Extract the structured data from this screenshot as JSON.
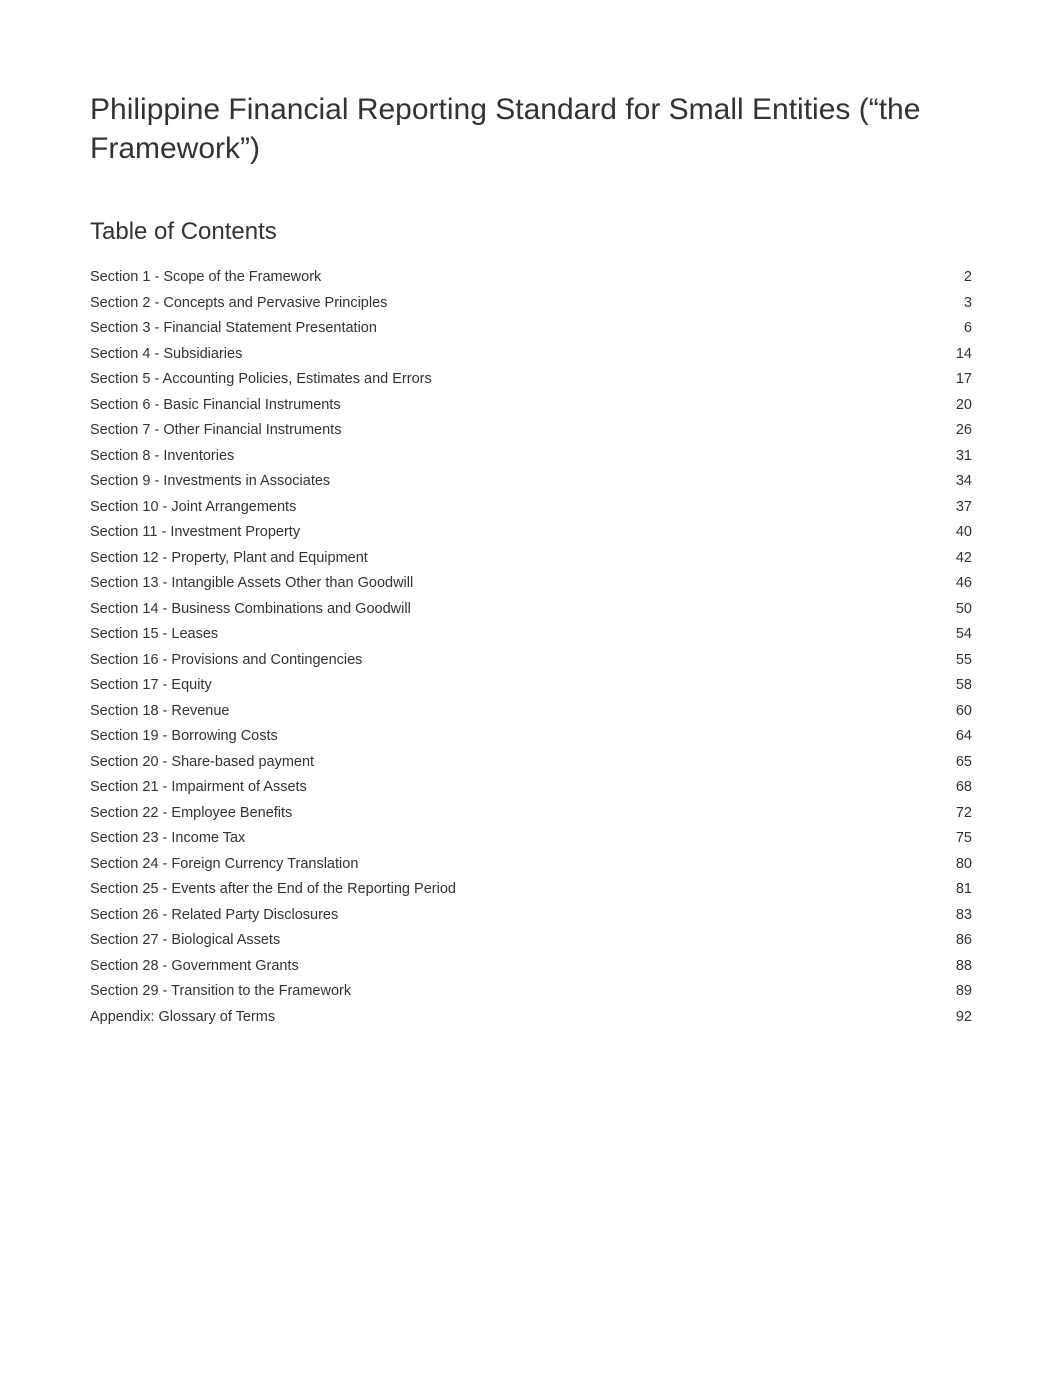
{
  "title": "Philippine Financial Reporting Standard for Small Entities (“the Framework”)",
  "toc_heading": "Table of Contents",
  "toc": [
    {
      "label": "Section 1 - Scope of the Framework",
      "page": "2"
    },
    {
      "label": "Section 2 - Concepts and Pervasive Principles",
      "page": "3"
    },
    {
      "label": "Section 3 - Financial Statement Presentation",
      "page": "6"
    },
    {
      "label": "Section 4 - Subsidiaries",
      "page": "14"
    },
    {
      "label": "Section 5 - Accounting Policies, Estimates and Errors",
      "page": "17"
    },
    {
      "label": "Section 6 - Basic Financial Instruments",
      "page": "20"
    },
    {
      "label": "Section 7 - Other Financial Instruments",
      "page": "26"
    },
    {
      "label": "Section 8 - Inventories",
      "page": "31"
    },
    {
      "label": "Section 9 - Investments in Associates",
      "page": "34"
    },
    {
      "label": "Section 10 - Joint Arrangements",
      "page": "37"
    },
    {
      "label": "Section 11 - Investment Property",
      "page": "40"
    },
    {
      "label": "Section 12 - Property, Plant and Equipment",
      "page": "42"
    },
    {
      "label": "Section 13 - Intangible Assets Other than Goodwill",
      "page": "46"
    },
    {
      "label": "Section 14 - Business Combinations and Goodwill",
      "page": "50"
    },
    {
      "label": "Section 15 - Leases",
      "page": "54"
    },
    {
      "label": "Section 16 - Provisions and Contingencies",
      "page": "55"
    },
    {
      "label": "Section 17 - Equity",
      "page": "58"
    },
    {
      "label": "Section 18 - Revenue",
      "page": "60"
    },
    {
      "label": "Section 19 - Borrowing Costs",
      "page": "64"
    },
    {
      "label": "Section 20 - Share-based payment",
      "page": "65"
    },
    {
      "label": "Section 21 - Impairment of Assets",
      "page": "68"
    },
    {
      "label": "Section 22 - Employee Benefits",
      "page": "72"
    },
    {
      "label": "Section 23 - Income Tax",
      "page": "75"
    },
    {
      "label": "Section 24 - Foreign Currency Translation",
      "page": "80"
    },
    {
      "label": "Section 25 - Events after the End of the Reporting Period",
      "page": "81"
    },
    {
      "label": "Section 26 - Related Party Disclosures",
      "page": "83"
    },
    {
      "label": "Section 27 - Biological Assets",
      "page": "86"
    },
    {
      "label": "Section 28 - Government Grants",
      "page": "88"
    },
    {
      "label": "Section 29 - Transition to the Framework",
      "page": "89"
    },
    {
      "label": "Appendix: Glossary of Terms",
      "page": "92"
    }
  ]
}
